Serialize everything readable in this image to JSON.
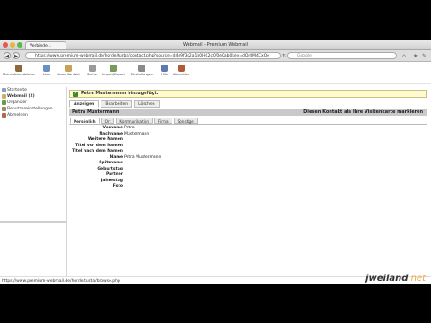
{
  "browser": {
    "tab_label": "Verbinde...",
    "window_title": "Webmail - Premium Webmail",
    "url": "https://www.premium-webmail.de/horde/turba/contact.php?source=d4e9f3c2a1b0HC2c0f0e0ab0key=dQr8M4CxOe",
    "search_placeholder": "Google"
  },
  "toolbar": {
    "buttons": [
      "Meine Adressbücher",
      "Liste",
      "Neuer Kontakt",
      "Suche",
      "Import/Export",
      "Einstellungen",
      "Hilfe",
      "Abmelden"
    ]
  },
  "sidebar": {
    "items": [
      {
        "label": "Startseite"
      },
      {
        "label": "Webmail (2)"
      },
      {
        "label": "Organizer"
      },
      {
        "label": "Benutzereinstellungen"
      },
      {
        "label": "Abmelden"
      }
    ]
  },
  "notice": "Petra Mustermann hinzugefügt.",
  "action_tabs": [
    "Anzeigen",
    "Bearbeiten",
    "Löschen"
  ],
  "contact": {
    "name": "Petra Mustermann",
    "mark_vcard": "Diesen Kontakt als Ihre Visitenkarte markieren"
  },
  "section_tabs": [
    "Persönlich",
    "Ort",
    "Kommunikation",
    "Firma",
    "Sonstige"
  ],
  "fields": [
    {
      "label": "Vorname",
      "value": "Petra"
    },
    {
      "label": "Nachname",
      "value": "Mustermann"
    },
    {
      "label": "Weitere Namen",
      "value": ""
    },
    {
      "label": "Titel vor dem Namen",
      "value": ""
    },
    {
      "label": "Titel nach dem Namen",
      "value": ""
    },
    {
      "label": "Name",
      "value": "Petra Mustermann"
    },
    {
      "label": "Spitzname",
      "value": ""
    },
    {
      "label": "Geburtstag",
      "value": ""
    },
    {
      "label": "Partner",
      "value": ""
    },
    {
      "label": "Jahrestag",
      "value": ""
    },
    {
      "label": "Foto",
      "value": ""
    }
  ],
  "status_url": "https://www.premium-webmail.de/horde/turba/browse.php",
  "watermark": {
    "main": "jweiland",
    "suffix": ".net"
  }
}
